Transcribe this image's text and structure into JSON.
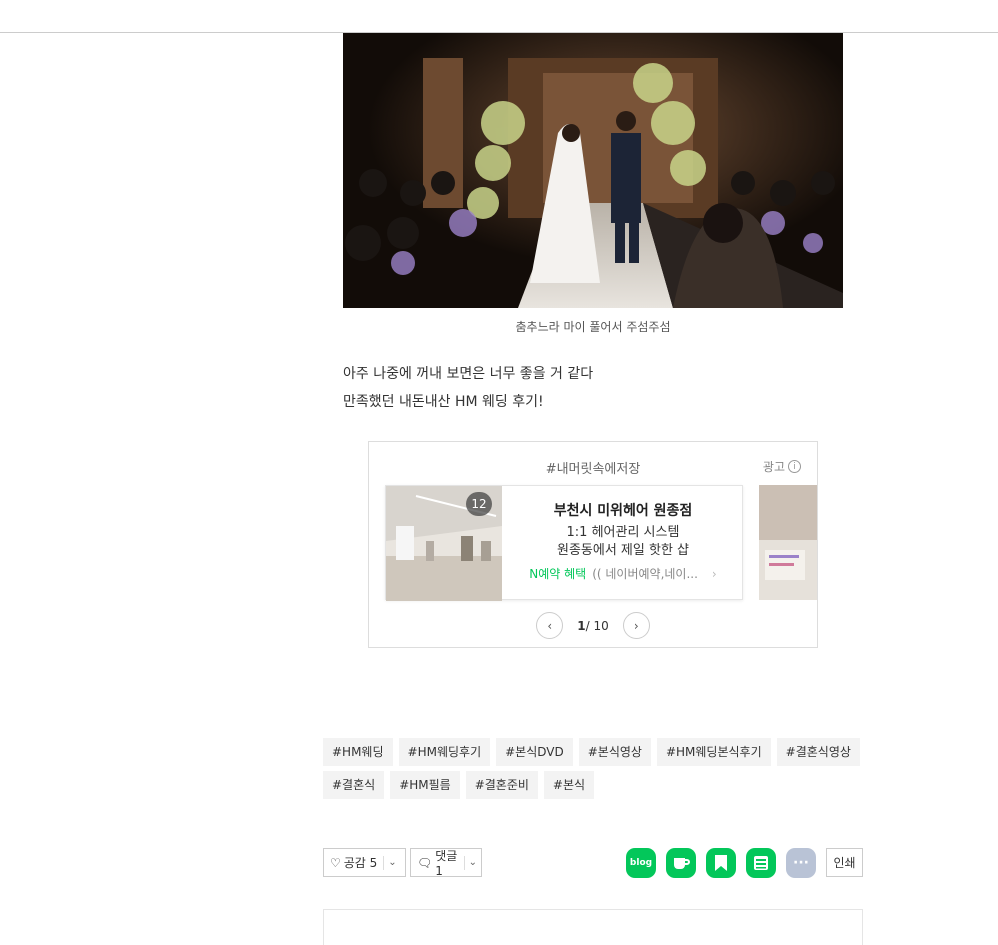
{
  "photo": {
    "alt_icon": "wedding-photo"
  },
  "caption": "춤추느라 마이 풀어서 주섬주섬",
  "body_lines": [
    "아주 나중에 꺼내 보면은 너무 좋을 거 같다",
    "만족했던 내돈내산 HM 웨딩 후기!"
  ],
  "ad": {
    "hashtag": "#내머릿속에저장",
    "label": "광고",
    "badge": "12",
    "title": "부천시 미위헤어 원종점",
    "line1": "1:1 헤어관리 시스템",
    "line2": "원종동에서 제일 핫한 샵",
    "meta_green": "N예약 혜택",
    "meta_gray": "(( 네이버예약,네이...",
    "page_current": "1",
    "page_total": "/ 10"
  },
  "tags": [
    "#HM웨딩",
    "#HM웨딩후기",
    "#본식DVD",
    "#본식영상",
    "#HM웨딩본식후기",
    "#결혼식영상",
    "#결혼식",
    "#HM필름",
    "#결혼준비",
    "#본식"
  ],
  "actions": {
    "like_label": "공감 5",
    "comment_label": "댓글 1",
    "print_label": "인쇄",
    "blog_icon_text": "blog",
    "more_icon_text": "···"
  },
  "colors": {
    "naver_green": "#03c75a",
    "more_gray": "#b9c3d6"
  }
}
